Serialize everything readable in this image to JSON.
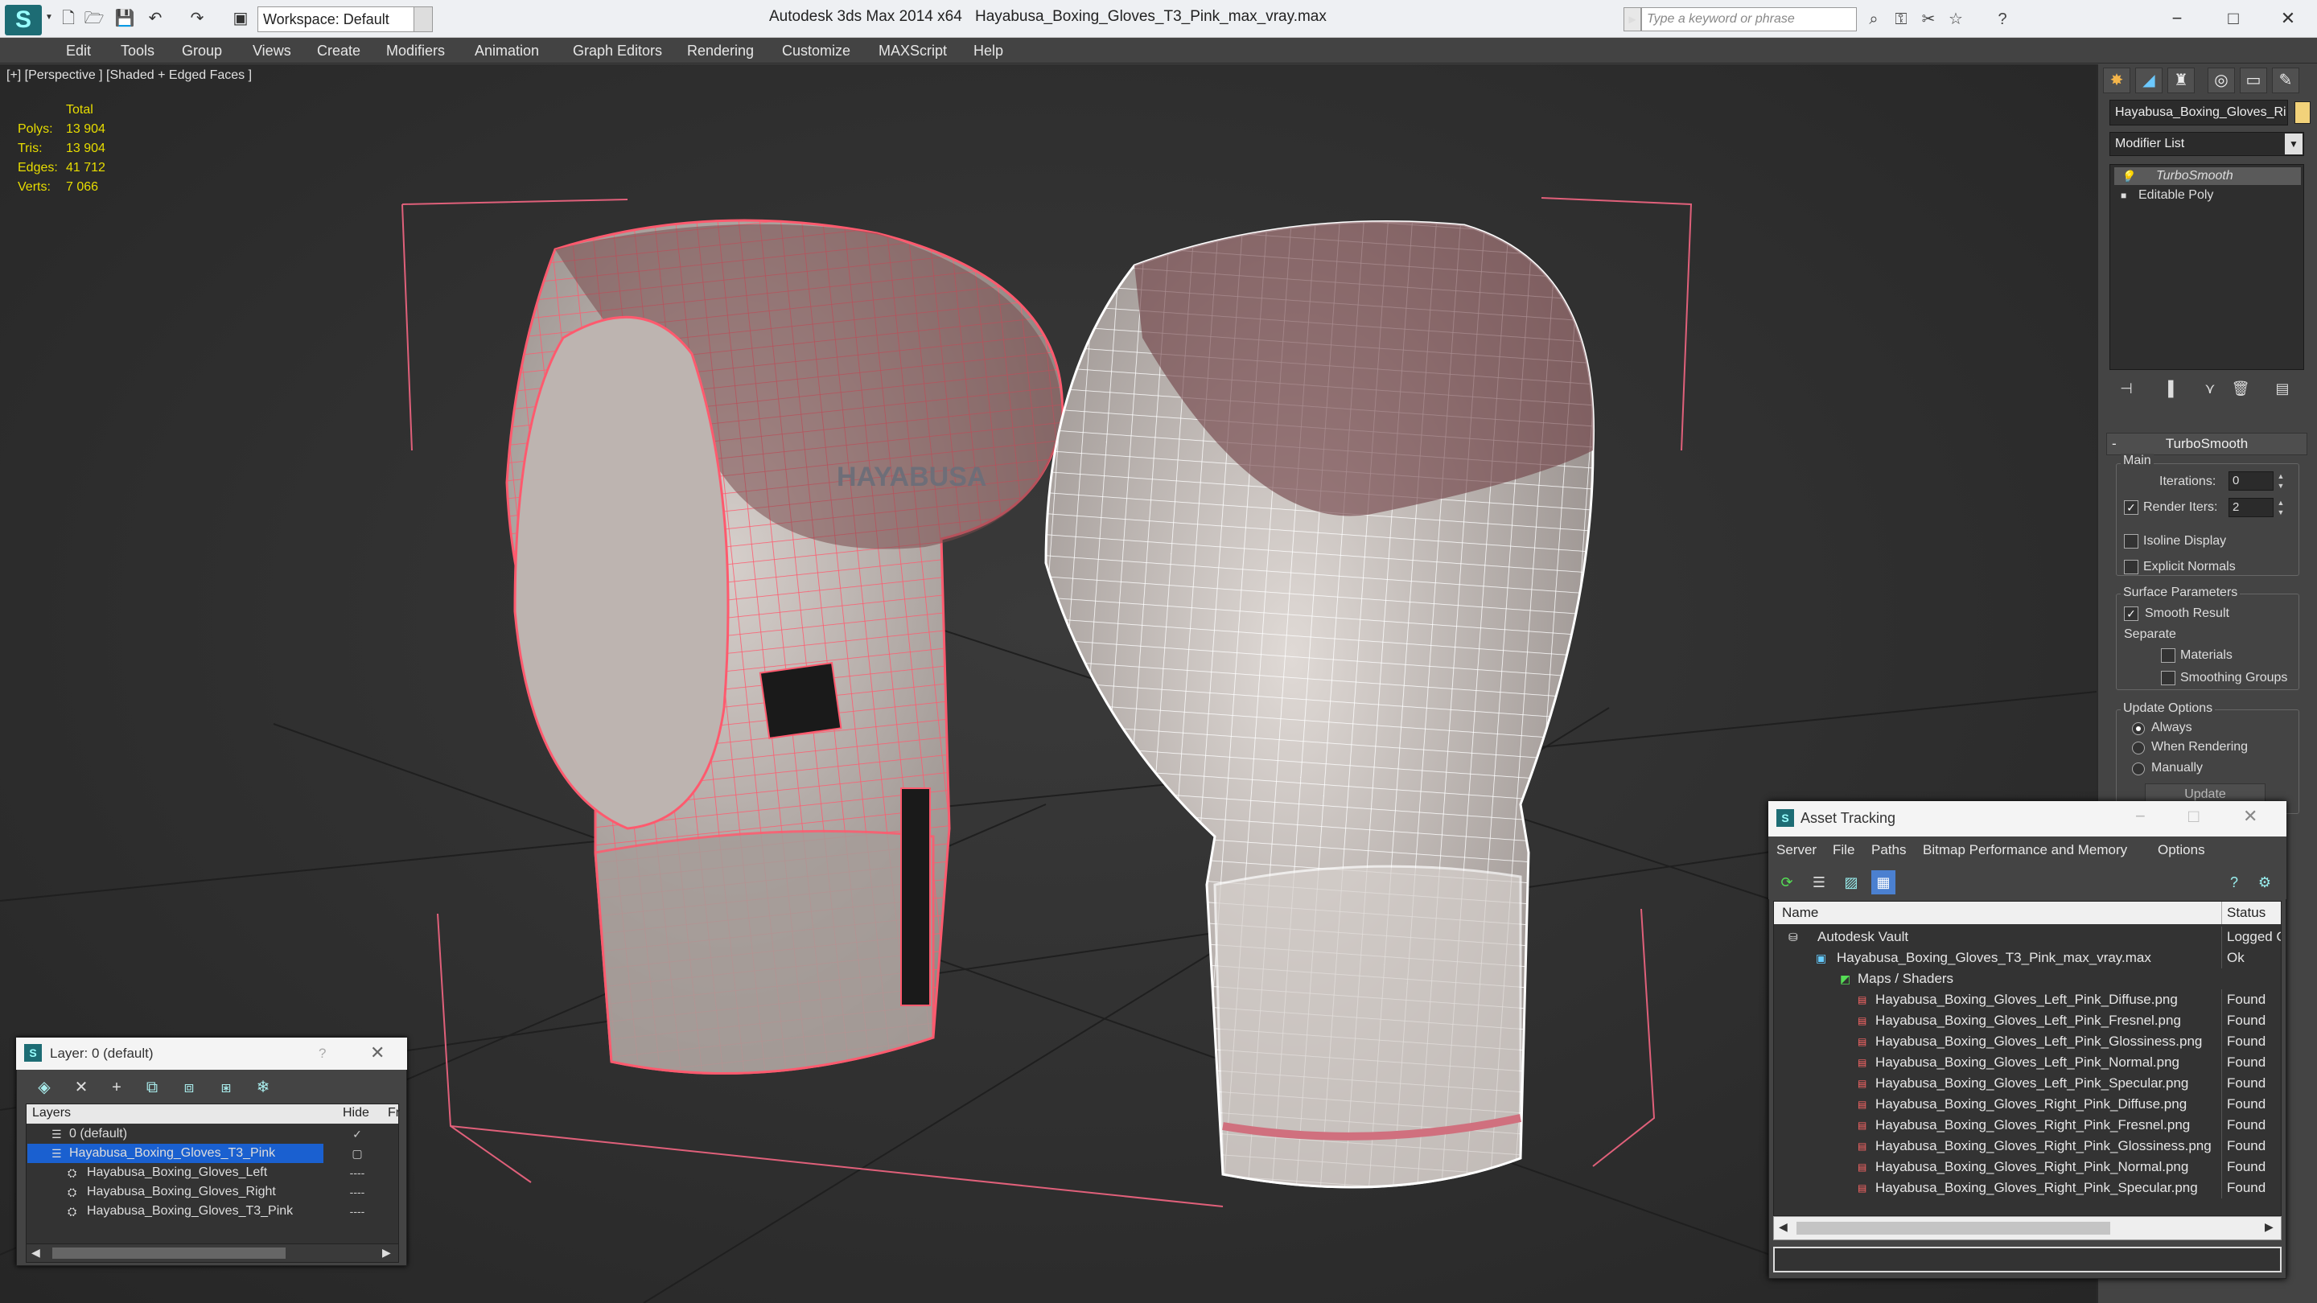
{
  "titlebar": {
    "workspace": "Workspace: Default",
    "app_title": "Autodesk 3ds Max  2014 x64",
    "file_title": "Hayabusa_Boxing_Gloves_T3_Pink_max_vray.max",
    "search_placeholder": "Type a keyword or phrase",
    "quick_access_icons": [
      "new-file-icon",
      "open-file-icon",
      "save-icon",
      "undo-icon",
      "redo-icon",
      "project-folder-icon"
    ],
    "info_icons": [
      "binoculars-icon",
      "key-icon",
      "link-icon",
      "star-icon",
      "help-icon"
    ],
    "window_controls": [
      "−",
      "□",
      "✕"
    ]
  },
  "menubar": [
    "Edit",
    "Tools",
    "Group",
    "Views",
    "Create",
    "Modifiers",
    "Animation",
    "Graph Editors",
    "Rendering",
    "Customize",
    "MAXScript",
    "Help"
  ],
  "viewport": {
    "label": "[+] [Perspective ] [Shaded + Edged Faces ]",
    "stats": {
      "total_label": "Total",
      "rows": [
        {
          "label": "Polys:",
          "value": "13 904"
        },
        {
          "label": "Tris:",
          "value": "13 904"
        },
        {
          "label": "Edges:",
          "value": "41 712"
        },
        {
          "label": "Verts:",
          "value": "7 066"
        }
      ]
    },
    "watermark": "HAYABUSA"
  },
  "command_panel": {
    "tab_icons": [
      "create-icon",
      "modify-icon",
      "hierarchy-icon",
      "motion-icon",
      "display-icon",
      "utilities-icon"
    ],
    "object_name": "Hayabusa_Boxing_Gloves_Ri",
    "object_color": "#f2d27a",
    "modifier_list": "Modifier List",
    "stack": [
      "TurboSmooth",
      "Editable Poly"
    ],
    "rollout_title": "TurboSmooth",
    "main_group": "Main",
    "iterations_label": "Iterations:",
    "iterations_value": "0",
    "render_iters_label": "Render Iters:",
    "render_iters_value": "2",
    "render_iters_checked": true,
    "isoline_label": "Isoline Display",
    "explicit_normals_label": "Explicit Normals",
    "surface_group": "Surface Parameters",
    "smooth_result_label": "Smooth Result",
    "separate_label": "Separate",
    "materials_label": "Materials",
    "smoothing_groups_label": "Smoothing Groups",
    "update_group": "Update Options",
    "always_label": "Always",
    "when_rendering_label": "When Rendering",
    "manually_label": "Manually",
    "update_button": "Update"
  },
  "layer_window": {
    "title": "Layer: 0 (default)",
    "help": "?",
    "close": "✕",
    "col_layers": "Layers",
    "col_hide": "Hide",
    "col_fr": "Fr",
    "rows": [
      {
        "name": "0 (default)",
        "indent": 0,
        "selected": false,
        "hide": "✓"
      },
      {
        "name": "Hayabusa_Boxing_Gloves_T3_Pink",
        "indent": 0,
        "selected": true,
        "hide": "▢"
      },
      {
        "name": "Hayabusa_Boxing_Gloves_Left",
        "indent": 1,
        "selected": false,
        "hide": "----"
      },
      {
        "name": "Hayabusa_Boxing_Gloves_Right",
        "indent": 1,
        "selected": false,
        "hide": "----"
      },
      {
        "name": "Hayabusa_Boxing_Gloves_T3_Pink",
        "indent": 1,
        "selected": false,
        "hide": "----"
      }
    ]
  },
  "asset_tracking": {
    "title": "Asset Tracking",
    "menus": [
      "Server",
      "File",
      "Paths",
      "Bitmap Performance and Memory",
      "Options"
    ],
    "col_name": "Name",
    "col_status": "Status",
    "rows": [
      {
        "name": "Autodesk Vault",
        "status": "Logged Out",
        "level": 0,
        "icon": "vault-icon"
      },
      {
        "name": "Hayabusa_Boxing_Gloves_T3_Pink_max_vray.max",
        "status": "Ok",
        "level": 1,
        "icon": "max-file-icon"
      },
      {
        "name": "Maps / Shaders",
        "status": "",
        "level": 2,
        "icon": "maps-icon"
      },
      {
        "name": "Hayabusa_Boxing_Gloves_Left_Pink_Diffuse.png",
        "status": "Found",
        "level": 3,
        "icon": "png-icon"
      },
      {
        "name": "Hayabusa_Boxing_Gloves_Left_Pink_Fresnel.png",
        "status": "Found",
        "level": 3,
        "icon": "png-icon"
      },
      {
        "name": "Hayabusa_Boxing_Gloves_Left_Pink_Glossiness.png",
        "status": "Found",
        "level": 3,
        "icon": "png-icon"
      },
      {
        "name": "Hayabusa_Boxing_Gloves_Left_Pink_Normal.png",
        "status": "Found",
        "level": 3,
        "icon": "png-icon"
      },
      {
        "name": "Hayabusa_Boxing_Gloves_Left_Pink_Specular.png",
        "status": "Found",
        "level": 3,
        "icon": "png-icon"
      },
      {
        "name": "Hayabusa_Boxing_Gloves_Right_Pink_Diffuse.png",
        "status": "Found",
        "level": 3,
        "icon": "png-icon"
      },
      {
        "name": "Hayabusa_Boxing_Gloves_Right_Pink_Fresnel.png",
        "status": "Found",
        "level": 3,
        "icon": "png-icon"
      },
      {
        "name": "Hayabusa_Boxing_Gloves_Right_Pink_Glossiness.png",
        "status": "Found",
        "level": 3,
        "icon": "png-icon"
      },
      {
        "name": "Hayabusa_Boxing_Gloves_Right_Pink_Normal.png",
        "status": "Found",
        "level": 3,
        "icon": "png-icon"
      },
      {
        "name": "Hayabusa_Boxing_Gloves_Right_Pink_Specular.png",
        "status": "Found",
        "level": 3,
        "icon": "png-icon"
      }
    ]
  },
  "colors": {
    "accent": "#1d6c74",
    "selection": "#1a60d0",
    "wire_left": "#ff5a6e",
    "wire_right": "#ffffff",
    "stats_text": "#e8dd00"
  }
}
